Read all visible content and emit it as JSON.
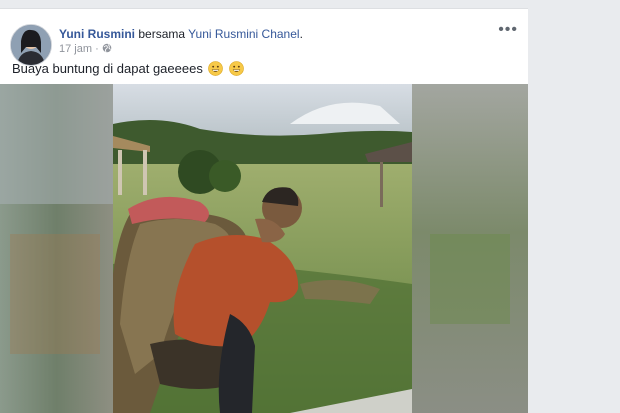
{
  "post": {
    "author_name": "Yuni Rusmini",
    "with_text": "bersama",
    "page_name": "Yuni Rusmini Chanel",
    "page_suffix": ".",
    "timestamp": "17 jam",
    "separator": "·",
    "privacy_icon": "globe-icon",
    "more_label": "•••",
    "caption": "Buaya buntung di dapat gaeeees",
    "emojis": [
      "grinning-face-icon",
      "grinning-face-icon"
    ]
  },
  "colors": {
    "link": "#365899",
    "meta": "#90949c",
    "text": "#1d2129",
    "background": "#e9ebee"
  }
}
